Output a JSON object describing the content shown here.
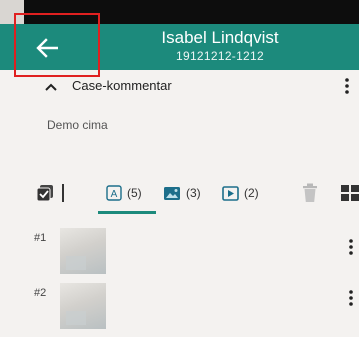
{
  "header": {
    "title": "Isabel Lindqvist",
    "subtitle": "19121212-1212",
    "accent_color": "#1c8a7c",
    "back_icon": "arrow-left-icon"
  },
  "section": {
    "label": "Case-kommentar",
    "comment": "Demo cima"
  },
  "tabs": [
    {
      "icon": "text-file-icon",
      "count": "(5)"
    },
    {
      "icon": "image-icon",
      "count": "(3)"
    },
    {
      "icon": "video-icon",
      "count": "(2)"
    }
  ],
  "list": [
    {
      "number": "#1"
    },
    {
      "number": "#2"
    }
  ]
}
